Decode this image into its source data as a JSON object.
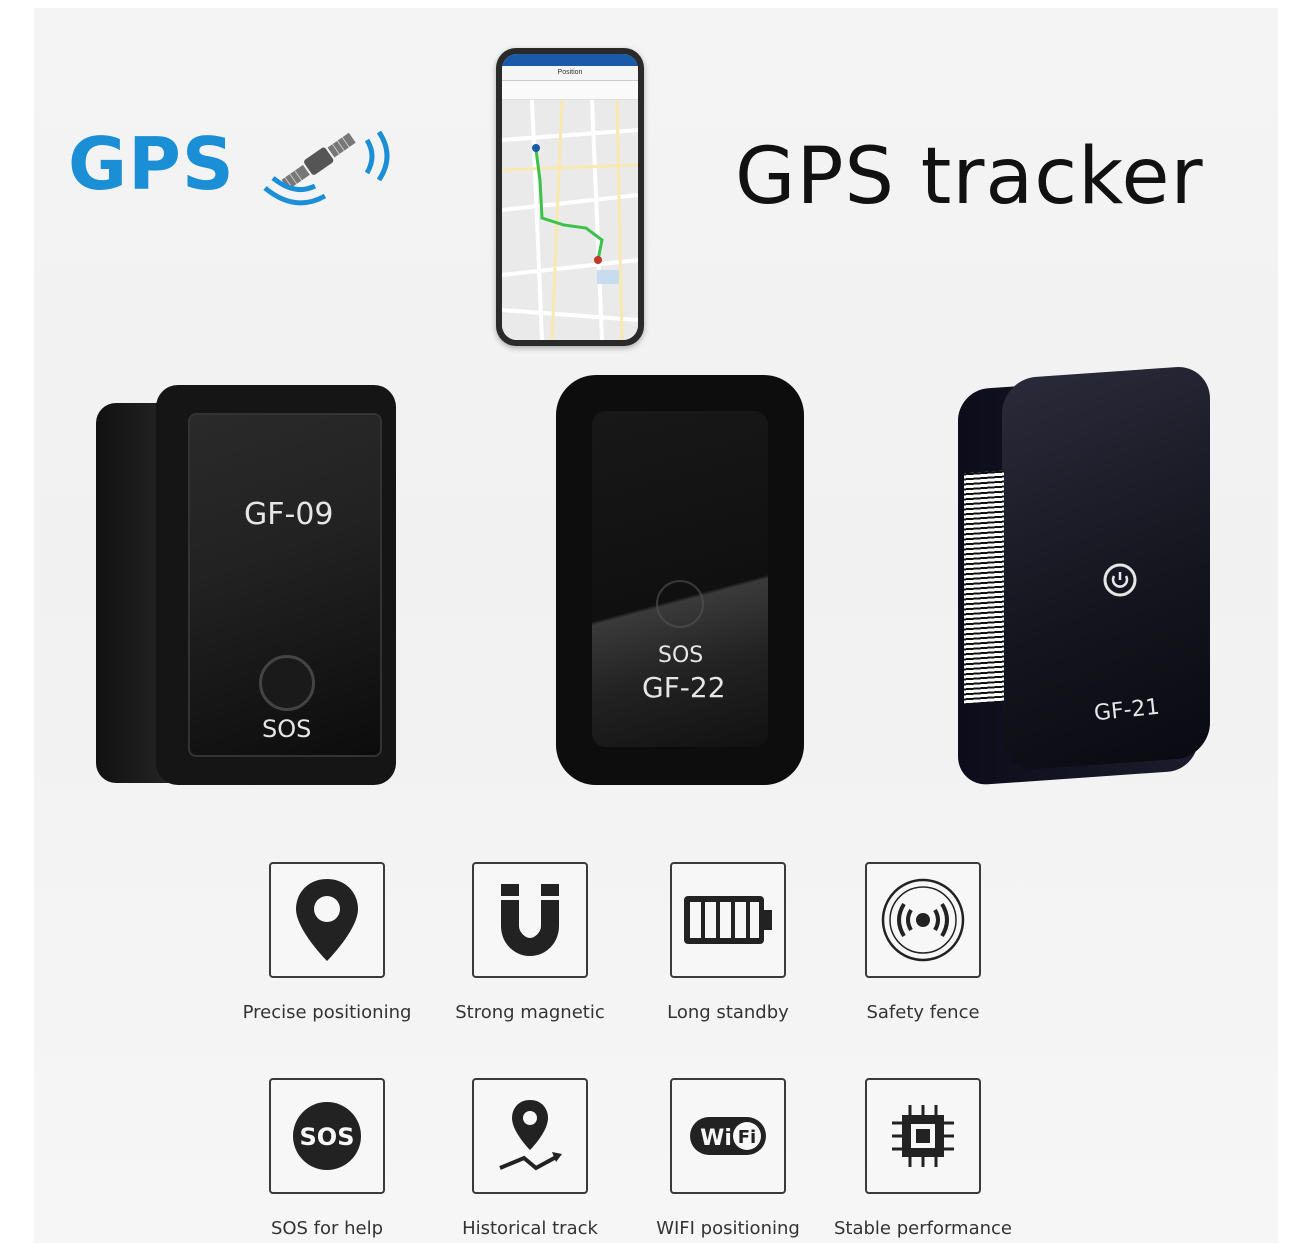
{
  "header": {
    "logo_text": "GPS",
    "title": "GPS tracker"
  },
  "phone": {
    "app_title": "Position"
  },
  "devices": [
    {
      "model": "GF-09",
      "button_text": "SOS"
    },
    {
      "model": "GF-22",
      "button_text": "SOS"
    },
    {
      "model": "GF-21"
    }
  ],
  "features": [
    {
      "label": "Precise positioning",
      "icon": "location-pin-icon"
    },
    {
      "label": "Strong magnetic",
      "icon": "magnet-icon"
    },
    {
      "label": "Long standby",
      "icon": "battery-icon"
    },
    {
      "label": "Safety fence",
      "icon": "signal-fence-icon"
    },
    {
      "label": "SOS for help",
      "icon": "sos-icon"
    },
    {
      "label": "Historical track",
      "icon": "track-icon"
    },
    {
      "label": "WIFI positioning",
      "icon": "wifi-icon"
    },
    {
      "label": "Stable performance",
      "icon": "chip-icon"
    }
  ],
  "colors": {
    "brand_blue": "#1b8fd6",
    "route_green": "#3cc24a",
    "background": "#f3f3f3"
  }
}
